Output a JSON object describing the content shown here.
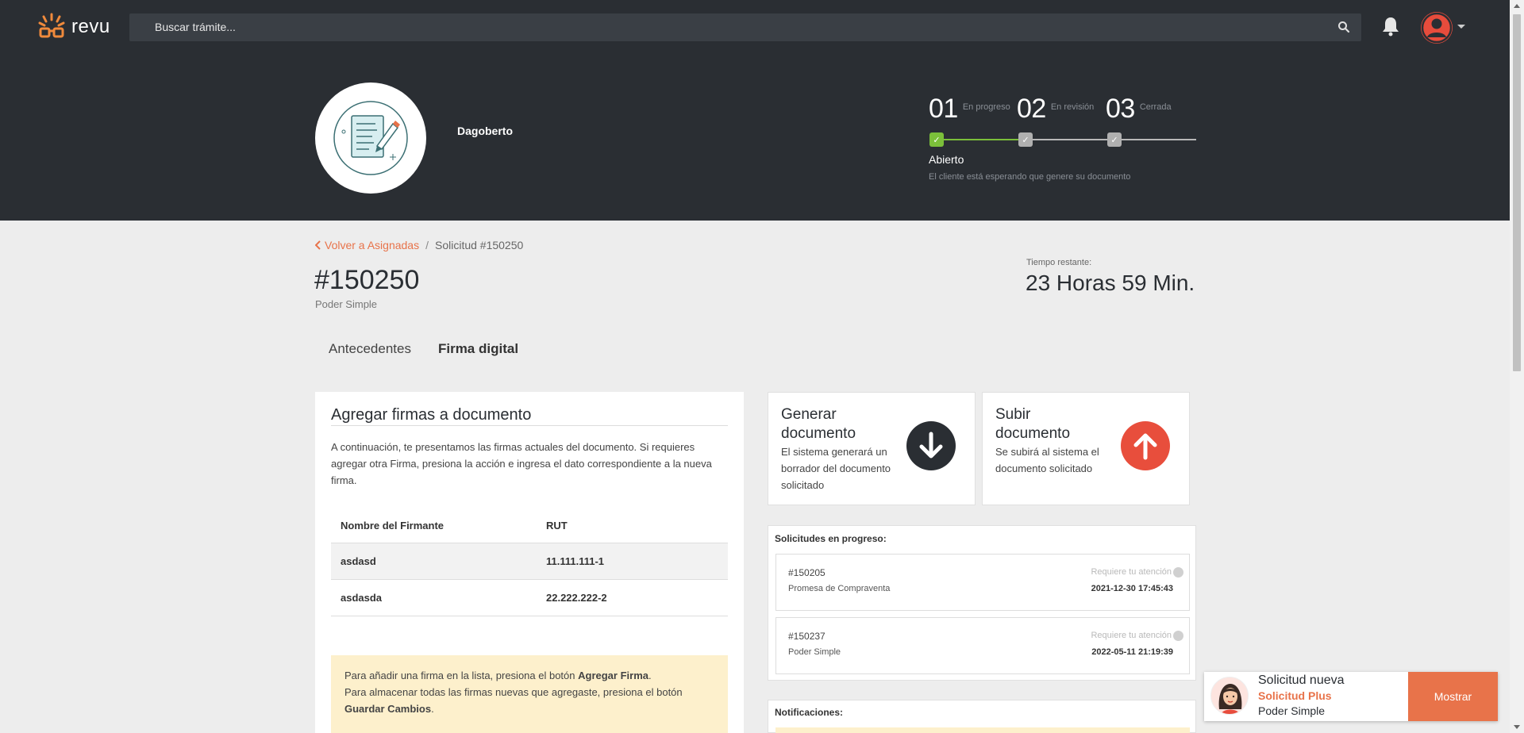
{
  "topbar": {
    "brand": "revu",
    "search_placeholder": "Buscar trámite..."
  },
  "hero": {
    "client_name": "Dagoberto",
    "steps": [
      {
        "num": "01",
        "label": "En progreso"
      },
      {
        "num": "02",
        "label": "En revisión"
      },
      {
        "num": "03",
        "label": "Cerrada"
      }
    ],
    "status_title": "Abierto",
    "status_desc": "El cliente está esperando que genere su documento"
  },
  "breadcrumb": {
    "back": "Volver a Asignadas",
    "separator": "/",
    "current": "Solicitud #150250"
  },
  "request": {
    "id": "#150250",
    "type": "Poder Simple",
    "time_label": "Tiempo restante:",
    "time_value": "23 Horas 59 Min."
  },
  "tabs": [
    "Antecedentes",
    "Firma digital"
  ],
  "signatures": {
    "title": "Agregar firmas a documento",
    "intro": "A continuación, te presentamos las firmas actuales del documento. Si requieres agregar otra Firma, presiona la acción e ingresa el dato correspondiente a la nueva firma.",
    "headers": [
      "Nombre del Firmante",
      "RUT"
    ],
    "rows": [
      {
        "name": "asdasd",
        "rut": "11.111.111-1"
      },
      {
        "name": "asdasda",
        "rut": "22.222.222-2"
      }
    ],
    "note": {
      "l1_pre": "Para añadir una firma en la lista, presiona el botón ",
      "l1_bold": "Agregar Firma",
      "l1_post": ".",
      "l2_pre": "Para almacenar todas las firmas nuevas que agregaste, presiona el botón ",
      "l2_bold": "Guardar Cambios",
      "l2_post": "."
    }
  },
  "actions": {
    "generate": {
      "title": "Generar documento",
      "desc": "El sistema generará un borrador del documento solicitado"
    },
    "upload": {
      "title": "Subir documento",
      "desc": "Se subirá al sistema el documento solicitado"
    }
  },
  "in_progress": {
    "title": "Solicitudes en progreso:",
    "items": [
      {
        "id": "#150205",
        "type": "Promesa de Compraventa",
        "attention": "Requiere tu atención",
        "date": "2021-12-30 17:45:43"
      },
      {
        "id": "#150237",
        "type": "Poder Simple",
        "attention": "Requiere tu atención",
        "date": "2022-05-11 21:19:39"
      }
    ]
  },
  "notifications": {
    "title": "Notificaciones:"
  },
  "toast": {
    "line1": "Solicitud nueva",
    "line2": "Solicitud Plus",
    "line3": "Poder Simple",
    "button": "Mostrar"
  },
  "colors": {
    "accent": "#e8734a",
    "dark": "#2a2e33",
    "green": "#7bbf3a",
    "note_bg": "#fdf0cc"
  }
}
